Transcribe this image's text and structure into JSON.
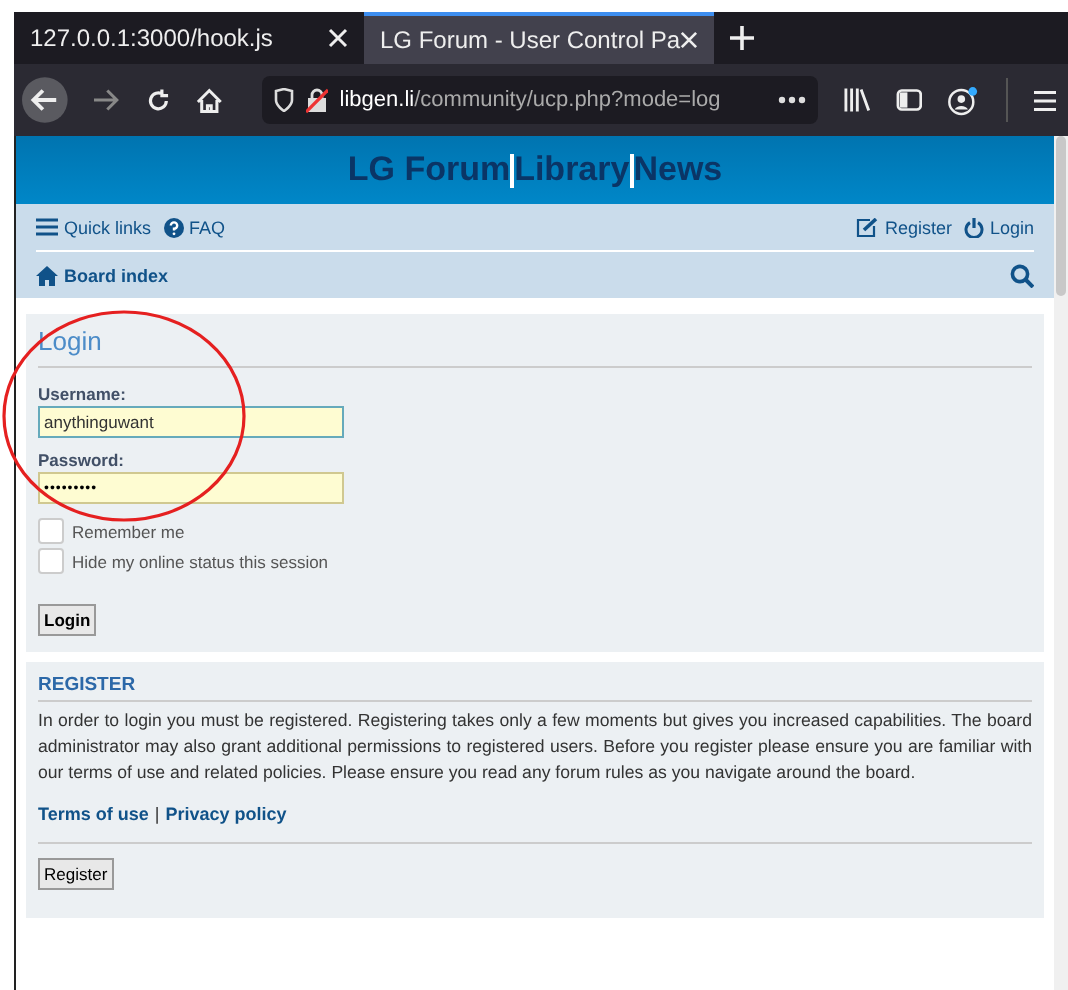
{
  "browser": {
    "tabs": [
      {
        "label": "127.0.0.1:3000/hook.js",
        "selected": false
      },
      {
        "label": "LG Forum - User Control Pa",
        "selected": true
      }
    ],
    "url_host": "libgen.li",
    "url_path": "/community/ucp.php?mode=log"
  },
  "site_title": {
    "parts": [
      "LG Forum",
      "Library",
      "News"
    ]
  },
  "nav": {
    "left": [
      "Quick links",
      "FAQ"
    ],
    "right": [
      "Register",
      "Login"
    ],
    "breadcrumb": "Board index"
  },
  "login": {
    "heading": "Login",
    "username_label": "Username:",
    "username_value": "anythinguwant",
    "password_label": "Password:",
    "password_value": "•••••••••",
    "options": [
      {
        "label": "Remember me",
        "checked": false
      },
      {
        "label": "Hide my online status this session",
        "checked": false
      }
    ],
    "button": "Login"
  },
  "register": {
    "heading": "REGISTER",
    "text": "In order to login you must be registered. Registering takes only a few moments but gives you increased capabilities. The board administrator may also grant additional permissions to registered users. Before you register please ensure you are familiar with our terms of use and related policies. Please ensure you read any forum rules as you navigate around the board.",
    "links": [
      "Terms of use",
      "Privacy policy"
    ],
    "separator": "|",
    "button": "Register"
  }
}
